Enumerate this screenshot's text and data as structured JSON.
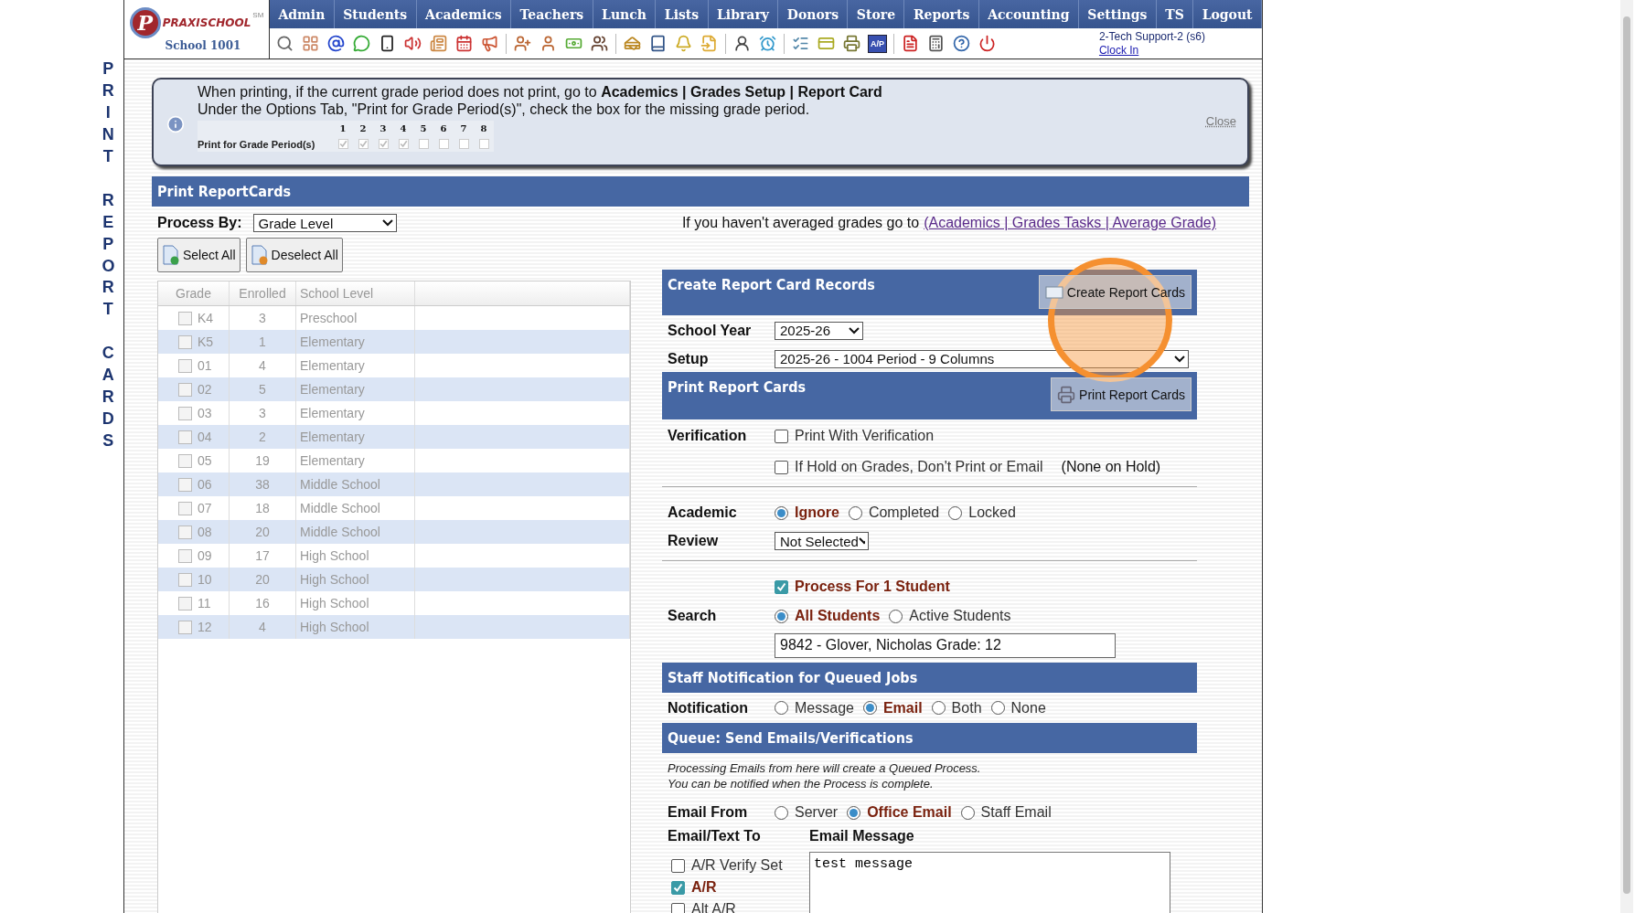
{
  "sidebar_title": [
    "PRINT",
    "REPORT",
    "CARDS"
  ],
  "header": {
    "logo_mark": "P",
    "logo_name": "PRAXISCHOOL",
    "logo_tm": "SM",
    "school": "School 1001",
    "nav": [
      {
        "label": "Admin"
      },
      {
        "label": "Students"
      },
      {
        "label": "Academics"
      },
      {
        "label": "Teachers"
      },
      {
        "label": "Lunch"
      },
      {
        "label": "Lists"
      },
      {
        "label": "Library"
      },
      {
        "label": "Donors"
      },
      {
        "label": "Store"
      },
      {
        "label": "Reports"
      },
      {
        "label": "Accounting"
      },
      {
        "label": "Settings"
      },
      {
        "label": "TS"
      },
      {
        "label": "Logout"
      }
    ],
    "ap_badge": "A/P",
    "user": "2-Tech Support-2 (s6)",
    "clock_link": "Clock In"
  },
  "notice": {
    "line1": "When printing, if the current grade period does not print, go to **Academics | Grades Setup | Report Card**",
    "line2": "Under the Options Tab, \"Print for Grade Period(s)\", check the box for the missing grade period.",
    "period_label": "Print for Grade Period(s)",
    "periods": [
      {
        "label": "1",
        "checked": true
      },
      {
        "label": "2",
        "checked": true
      },
      {
        "label": "3",
        "checked": true
      },
      {
        "label": "4",
        "checked": true
      },
      {
        "label": "5",
        "checked": false
      },
      {
        "label": "6",
        "checked": false
      },
      {
        "label": "7",
        "checked": false
      },
      {
        "label": "8",
        "checked": false
      }
    ],
    "close": "Close"
  },
  "print_section": {
    "title": "Print ReportCards",
    "process_by_label": "Process By:",
    "process_by": "Grade Level",
    "hint": "If you haven't averaged grades go to",
    "hint_link": "(Academics | Grades Tasks | Average Grade)",
    "select_all": "Select All",
    "deselect_all": "Deselect All"
  },
  "grades_table": {
    "columns": [
      "Grade",
      "Enrolled",
      "School Level"
    ],
    "rows": [
      {
        "grade": "K4",
        "enrolled": "3",
        "level": "Preschool",
        "checked": false
      },
      {
        "grade": "K5",
        "enrolled": "1",
        "level": "Elementary",
        "checked": false
      },
      {
        "grade": "01",
        "enrolled": "4",
        "level": "Elementary",
        "checked": false
      },
      {
        "grade": "02",
        "enrolled": "5",
        "level": "Elementary",
        "checked": false
      },
      {
        "grade": "03",
        "enrolled": "3",
        "level": "Elementary",
        "checked": false
      },
      {
        "grade": "04",
        "enrolled": "2",
        "level": "Elementary",
        "checked": false
      },
      {
        "grade": "05",
        "enrolled": "19",
        "level": "Elementary",
        "checked": false
      },
      {
        "grade": "06",
        "enrolled": "38",
        "level": "Middle School",
        "checked": false
      },
      {
        "grade": "07",
        "enrolled": "18",
        "level": "Middle School",
        "checked": false
      },
      {
        "grade": "08",
        "enrolled": "20",
        "level": "Middle School",
        "checked": false
      },
      {
        "grade": "09",
        "enrolled": "17",
        "level": "High School",
        "checked": false
      },
      {
        "grade": "10",
        "enrolled": "20",
        "level": "High School",
        "checked": false
      },
      {
        "grade": "11",
        "enrolled": "16",
        "level": "High School",
        "checked": false
      },
      {
        "grade": "12",
        "enrolled": "4",
        "level": "High School",
        "checked": false
      }
    ]
  },
  "create": {
    "title": "Create Report Card Records",
    "button": "Create Report Cards",
    "school_year_label": "School Year",
    "school_year": "2025-26",
    "setup_label": "Setup",
    "setup": "2025-26 - 1004 Period - 9 Columns"
  },
  "print": {
    "title": "Print Report Cards",
    "button": "Print Report Cards",
    "verification_label": "Verification",
    "verification": [
      {
        "label": "Print With Verification",
        "checked": false
      },
      {
        "label": "If Hold on Grades, Don't Print or Email",
        "checked": false
      }
    ],
    "hold_note": "(None on Hold)",
    "academic_label": "Academic",
    "academic": [
      {
        "label": "Ignore",
        "selected": true
      },
      {
        "label": "Completed",
        "selected": false
      },
      {
        "label": "Locked",
        "selected": false
      }
    ],
    "review_label": "Review",
    "review": "Not Selected",
    "single_student": {
      "label": "Process For 1 Student",
      "checked": true
    },
    "search_label": "Search",
    "search_scope": [
      {
        "label": "All Students",
        "selected": true
      },
      {
        "label": "Active Students",
        "selected": false
      }
    ],
    "student": "9842 - Glover, Nicholas Grade: 12"
  },
  "staff_notification": {
    "title": "Staff Notification for Queued Jobs",
    "label": "Notification",
    "options": [
      {
        "label": "Message",
        "selected": false
      },
      {
        "label": "Email",
        "selected": true
      },
      {
        "label": "Both",
        "selected": false
      },
      {
        "label": "None",
        "selected": false
      }
    ]
  },
  "queue": {
    "title": "Queue: Send Emails/Verifications",
    "note1": "Processing Emails from here will create a Queued Process.",
    "note2": "You can be notified when the Process is complete.",
    "email_from_label": "Email From",
    "email_from": [
      {
        "label": "Server",
        "selected": false
      },
      {
        "label": "Office Email",
        "selected": true
      },
      {
        "label": "Staff Email",
        "selected": false
      }
    ],
    "to_label": "Email/Text To",
    "message_label": "Email Message",
    "recipients": [
      {
        "label": "A/R Verify Set",
        "checked": false
      },
      {
        "label": "A/R",
        "checked": true
      },
      {
        "label": "Alt A/R",
        "checked": false
      }
    ],
    "message": "test message"
  }
}
